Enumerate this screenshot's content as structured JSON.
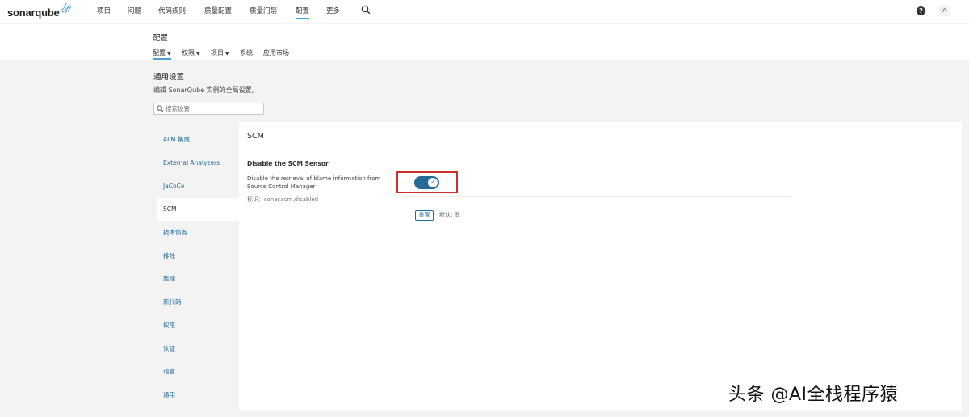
{
  "app": {
    "logo_text": "sonarqube"
  },
  "nav": {
    "items": [
      "项目",
      "问题",
      "代码规则",
      "质量配置",
      "质量门禁",
      "配置",
      "更多"
    ],
    "active": "配置",
    "help_label": "?",
    "avatar_letter": "A"
  },
  "page": {
    "title": "配置",
    "subnav": [
      {
        "label": "配置",
        "has_caret": true
      },
      {
        "label": "权限",
        "has_caret": true
      },
      {
        "label": "项目",
        "has_caret": true
      },
      {
        "label": "系统",
        "has_caret": false
      },
      {
        "label": "应用市场",
        "has_caret": false
      }
    ]
  },
  "settings": {
    "title": "通用设置",
    "description": "编辑 SonarQube 实例的全局设置。",
    "search_placeholder": "搜索设置"
  },
  "categories": [
    "ALM 集成",
    "External Analyzers",
    "JaCoCo",
    "SCM",
    "技术债务",
    "排除",
    "整理",
    "新代码",
    "权限",
    "认证",
    "语言",
    "通用"
  ],
  "active_category": "SCM",
  "panel": {
    "title": "SCM",
    "setting": {
      "name": "Disable the SCM Sensor",
      "description": "Disable the retrieval of blame information from Source Control Manager",
      "key": "标识：sonar.scm.disabled",
      "value": true,
      "reset_label": "重置",
      "default_label": "默认: 假"
    }
  },
  "colors": {
    "accent": "#236a97",
    "highlight": "#d02d2d",
    "tab_underline": "#4b9fd5"
  },
  "watermark": "头条 @AI全栈程序猿"
}
